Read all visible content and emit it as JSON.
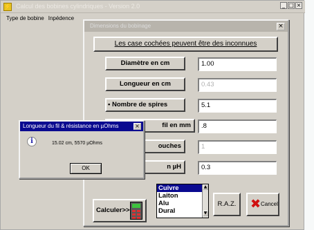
{
  "app": {
    "title": "Calcul des bobines cylindriques - Version 2.0",
    "menu": [
      "Type de bobine",
      "Inpédence"
    ]
  },
  "dialog": {
    "title": "Dimensions du bobinage",
    "header": "Les case cochées peuvent être des inconnues",
    "rows": [
      {
        "label": "Diamètre en cm",
        "value": "1.00",
        "dim": false
      },
      {
        "label": "Longueur en cm",
        "value": "0.43",
        "dim": true
      },
      {
        "label": "• Nombre de spires",
        "value": "5.1",
        "dim": false
      },
      {
        "label": "fil en mm",
        "value": ".8",
        "dim": false
      },
      {
        "label": "ouches",
        "value": "1",
        "dim": true
      },
      {
        "label": "n µH",
        "value": "0.3",
        "dim": false
      }
    ],
    "calc_label": "Calculer>>",
    "materials": [
      "Cuivre",
      "Laiton",
      "Alu",
      "Dural"
    ],
    "selected_material": "Cuivre",
    "raz_label": "R.A.Z.",
    "cancel_label": "Cancel"
  },
  "message": {
    "title": "Longueur du fil & résistance en µOhms",
    "text": "15.02 cm, 5570 µOhms",
    "ok_label": "OK"
  }
}
